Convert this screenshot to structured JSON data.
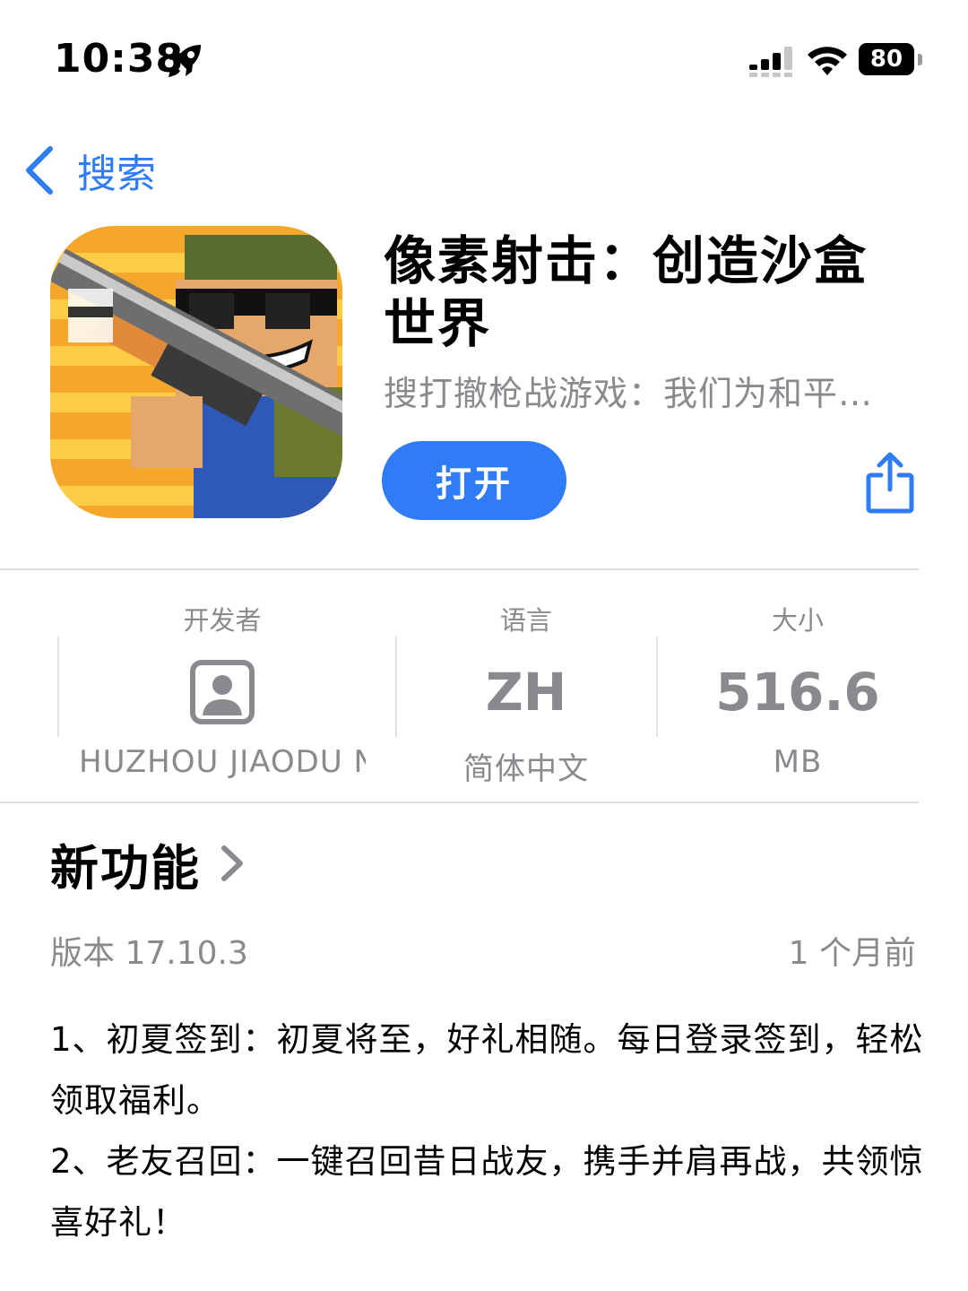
{
  "status_bar": {
    "time": "10:38",
    "battery": "80",
    "icons": [
      "rocket-icon",
      "cellular-signal-icon",
      "wifi-icon",
      "battery-icon"
    ]
  },
  "nav": {
    "back_label": "搜索"
  },
  "app": {
    "title": "像素射击：创造沙盒世界",
    "subtitle": "搜打撤枪战游戏：我们为和平…",
    "open_label": "打开"
  },
  "info": {
    "developer": {
      "header": "开发者",
      "value": "HUZHOU JIAODU N"
    },
    "language": {
      "header": "语言",
      "main": "ZH",
      "sub": "简体中文"
    },
    "size": {
      "header": "大小",
      "main": "516.6",
      "sub": "MB"
    }
  },
  "whats_new": {
    "title": "新功能",
    "version": "版本 17.10.3",
    "date": "1 个月前",
    "notes": [
      "1、初夏签到：初夏将至，好礼相随。每日登录签到，轻松领取福利。",
      "2、老友召回：一键召回昔日战友，携手并肩再战，共领惊喜好礼！"
    ]
  },
  "colors": {
    "accent": "#2f7cf6",
    "secondary_text": "#8a8a8e",
    "divider": "#dcdcdf"
  }
}
